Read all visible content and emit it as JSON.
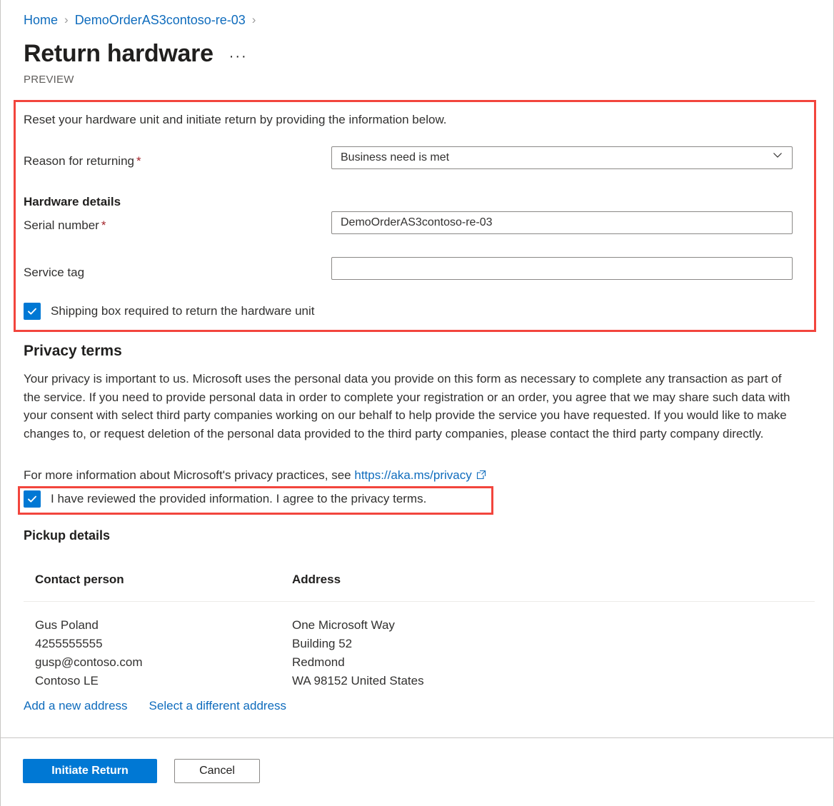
{
  "breadcrumb": {
    "items": [
      {
        "label": "Home"
      },
      {
        "label": "DemoOrderAS3contoso-re-03"
      }
    ],
    "separator": "›"
  },
  "header": {
    "title": "Return hardware",
    "more_options": "···",
    "preview_tag": "PREVIEW"
  },
  "form": {
    "intro": "Reset your hardware unit and initiate return by providing the information below.",
    "reason": {
      "label": "Reason for returning",
      "required_marker": "*",
      "value": "Business need is met",
      "icon": "chevron-down-icon"
    },
    "hardware_details_heading": "Hardware details",
    "serial_number": {
      "label": "Serial number",
      "required_marker": "*",
      "value": "DemoOrderAS3contoso-re-03",
      "placeholder": ""
    },
    "service_tag": {
      "label": "Service tag",
      "value": "",
      "placeholder": ""
    },
    "shipping_box_checkbox": {
      "label": "Shipping box required to return the hardware unit",
      "checked": true
    }
  },
  "privacy": {
    "heading": "Privacy terms",
    "body": "Your privacy is important to us. Microsoft uses the personal data you provide on this form as necessary to complete any transaction as part of the service. If you need to provide personal data in order to complete your registration or an order, you agree that we may share such data with your consent with select third party companies working on our behalf to help provide the service you have requested. If you would like to make changes to, or request deletion of the personal data provided to the third party companies, please contact the third party company directly.",
    "more_info_prefix": "For more information about Microsoft's privacy practices, see ",
    "link_text": "https://aka.ms/privacy",
    "link_icon": "external-link-icon",
    "agree_checkbox": {
      "label": "I have reviewed the provided information. I agree to the privacy terms.",
      "checked": true
    }
  },
  "pickup": {
    "heading": "Pickup details",
    "columns": [
      "Contact person",
      "Address"
    ],
    "rows": [
      {
        "contact": [
          "Gus Poland",
          "4255555555",
          "gusp@contoso.com",
          "Contoso LE"
        ],
        "address": [
          "One Microsoft Way",
          "Building 52",
          "Redmond",
          "WA 98152 United States"
        ]
      }
    ],
    "actions": [
      {
        "label": "Add a new address"
      },
      {
        "label": "Select a different address"
      }
    ]
  },
  "footer": {
    "primary_button": "Initiate Return",
    "secondary_button": "Cancel"
  },
  "annotations": {
    "color": "#f2453d",
    "boxes": [
      "form-section",
      "privacy-agree-checkbox"
    ]
  },
  "colors": {
    "accent": "#0078d4",
    "link": "#0f6cbd",
    "required": "#a4262c",
    "annotation": "#f2453d",
    "text": "#323130"
  }
}
